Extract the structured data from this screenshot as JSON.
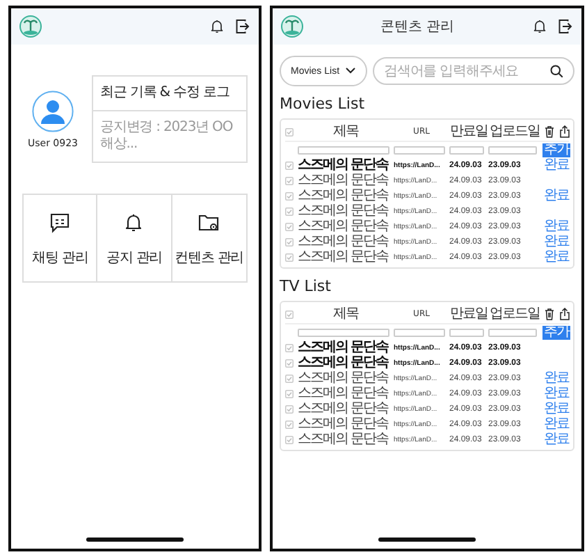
{
  "home": {
    "user": {
      "name": "User 0923"
    },
    "log_card": {
      "title": "최근 기록 & 수정 로그",
      "entry": "공지변경 : 2023년 OO해상..."
    },
    "menu": [
      {
        "label": "채팅 관리",
        "kind": "chat"
      },
      {
        "label": "공지 관리",
        "kind": "bell"
      },
      {
        "label": "컨텐츠 관리",
        "kind": "folder"
      }
    ]
  },
  "content": {
    "title": "콘텐츠 관리",
    "dropdown": "Movies List",
    "search": {
      "placeholder": "검색어를 입력해주세요"
    },
    "tables": [
      {
        "heading": "Movies List",
        "all_checked": false,
        "columns": [
          "제목",
          "URL",
          "만료일",
          "업로드일"
        ],
        "add_button": "추가",
        "rows": [
          {
            "checked": false,
            "title": "스즈메의 문단속",
            "url": "https://LanD...",
            "expires": "24.09.03",
            "uploaded": "23.09.03",
            "action": "완료",
            "bold": true
          },
          {
            "checked": false,
            "title": "스즈메의 문단속",
            "url": "https://LanD...",
            "expires": "24.09.03",
            "uploaded": "23.09.03",
            "bold": false
          },
          {
            "checked": false,
            "title": "스즈메의 문단속",
            "url": "https://LanD...",
            "expires": "24.09.03",
            "uploaded": "23.09.03",
            "action": "완료",
            "bold": false
          },
          {
            "checked": false,
            "title": "스즈메의 문단속",
            "url": "https://LanD...",
            "expires": "24.09.03",
            "uploaded": "23.09.03",
            "bold": false
          },
          {
            "checked": false,
            "title": "스즈메의 문단속",
            "url": "https://LanD...",
            "expires": "24.09.03",
            "uploaded": "23.09.03",
            "action": "완료",
            "bold": false
          },
          {
            "checked": false,
            "title": "스즈메의 문단속",
            "url": "https://LanD...",
            "expires": "24.09.03",
            "uploaded": "23.09.03",
            "action": "완료",
            "bold": false
          },
          {
            "checked": false,
            "title": "스즈메의 문단속",
            "url": "https://LanD...",
            "expires": "24.09.03",
            "uploaded": "23.09.03",
            "action": "완료",
            "bold": false
          }
        ]
      },
      {
        "heading": "TV List",
        "all_checked": false,
        "columns": [
          "제목",
          "URL",
          "만료일",
          "업로드일"
        ],
        "add_button": "추가",
        "rows": [
          {
            "checked": false,
            "title": "스즈메의 문단속",
            "url": "https://LanD...",
            "expires": "24.09.03",
            "uploaded": "23.09.03",
            "bold": true
          },
          {
            "checked": false,
            "title": "스즈메의 문단속",
            "url": "https://LanD...",
            "expires": "24.09.03",
            "uploaded": "23.09.03",
            "bold": true
          },
          {
            "checked": false,
            "title": "스즈메의 문단속",
            "url": "https://LanD...",
            "expires": "24.09.03",
            "uploaded": "23.09.03",
            "action": "완료",
            "bold": false
          },
          {
            "checked": false,
            "title": "스즈메의 문단속",
            "url": "https://LanD...",
            "expires": "24.09.03",
            "uploaded": "23.09.03",
            "action": "완료",
            "bold": false
          },
          {
            "checked": false,
            "title": "스즈메의 문단속",
            "url": "https://LanD...",
            "expires": "24.09.03",
            "uploaded": "23.09.03",
            "action": "완료",
            "bold": false
          },
          {
            "checked": false,
            "title": "스즈메의 문단속",
            "url": "https://LanD...",
            "expires": "24.09.03",
            "uploaded": "23.09.03",
            "action": "완료",
            "bold": false
          },
          {
            "checked": false,
            "title": "스즈메의 문단속",
            "url": "https://LanD...",
            "expires": "24.09.03",
            "uploaded": "23.09.03",
            "action": "완료",
            "bold": false
          }
        ]
      }
    ]
  }
}
